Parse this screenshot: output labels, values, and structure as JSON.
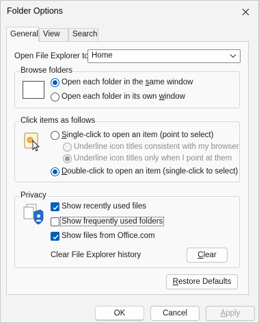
{
  "window": {
    "title": "Folder Options"
  },
  "tabs": [
    {
      "label": "General",
      "active": true
    },
    {
      "label": "View",
      "active": false
    },
    {
      "label": "Search",
      "active": false
    }
  ],
  "open_explorer": {
    "label": "Open File Explorer to:",
    "value": "Home"
  },
  "browse_folders": {
    "title": "Browse folders",
    "options": [
      {
        "pre": "Open each folder in the ",
        "accel": "s",
        "post": "ame window",
        "checked": true
      },
      {
        "pre": "Open each folder in its own ",
        "accel": "w",
        "post": "indow",
        "checked": false
      }
    ]
  },
  "click_items": {
    "title": "Click items as follows",
    "single": {
      "pre": "",
      "accel": "S",
      "post": "ingle-click to open an item (point to select)",
      "checked": false
    },
    "sub_options": [
      {
        "text": "Underline icon titles consistent with my browser",
        "checked": false
      },
      {
        "text": "Underline icon titles only when I point at them",
        "checked": true
      }
    ],
    "double": {
      "pre": "",
      "accel": "D",
      "post": "ouble-click to open an item (single-click to select)",
      "checked": true
    }
  },
  "privacy": {
    "title": "Privacy",
    "items": [
      {
        "text": "Show recently used files",
        "checked": true
      },
      {
        "text": "Show frequently used folders",
        "checked": false
      },
      {
        "text": "Show files from Office.com",
        "checked": true
      }
    ],
    "clear_history_label": "Clear File Explorer history",
    "clear_button": {
      "accel": "C",
      "rest": "lear"
    }
  },
  "buttons": {
    "restore": {
      "accel": "R",
      "rest": "estore Defaults"
    },
    "ok": "OK",
    "cancel": "Cancel",
    "apply": {
      "accel": "A",
      "rest": "pply"
    }
  },
  "colors": {
    "accent": "#005fb8"
  }
}
